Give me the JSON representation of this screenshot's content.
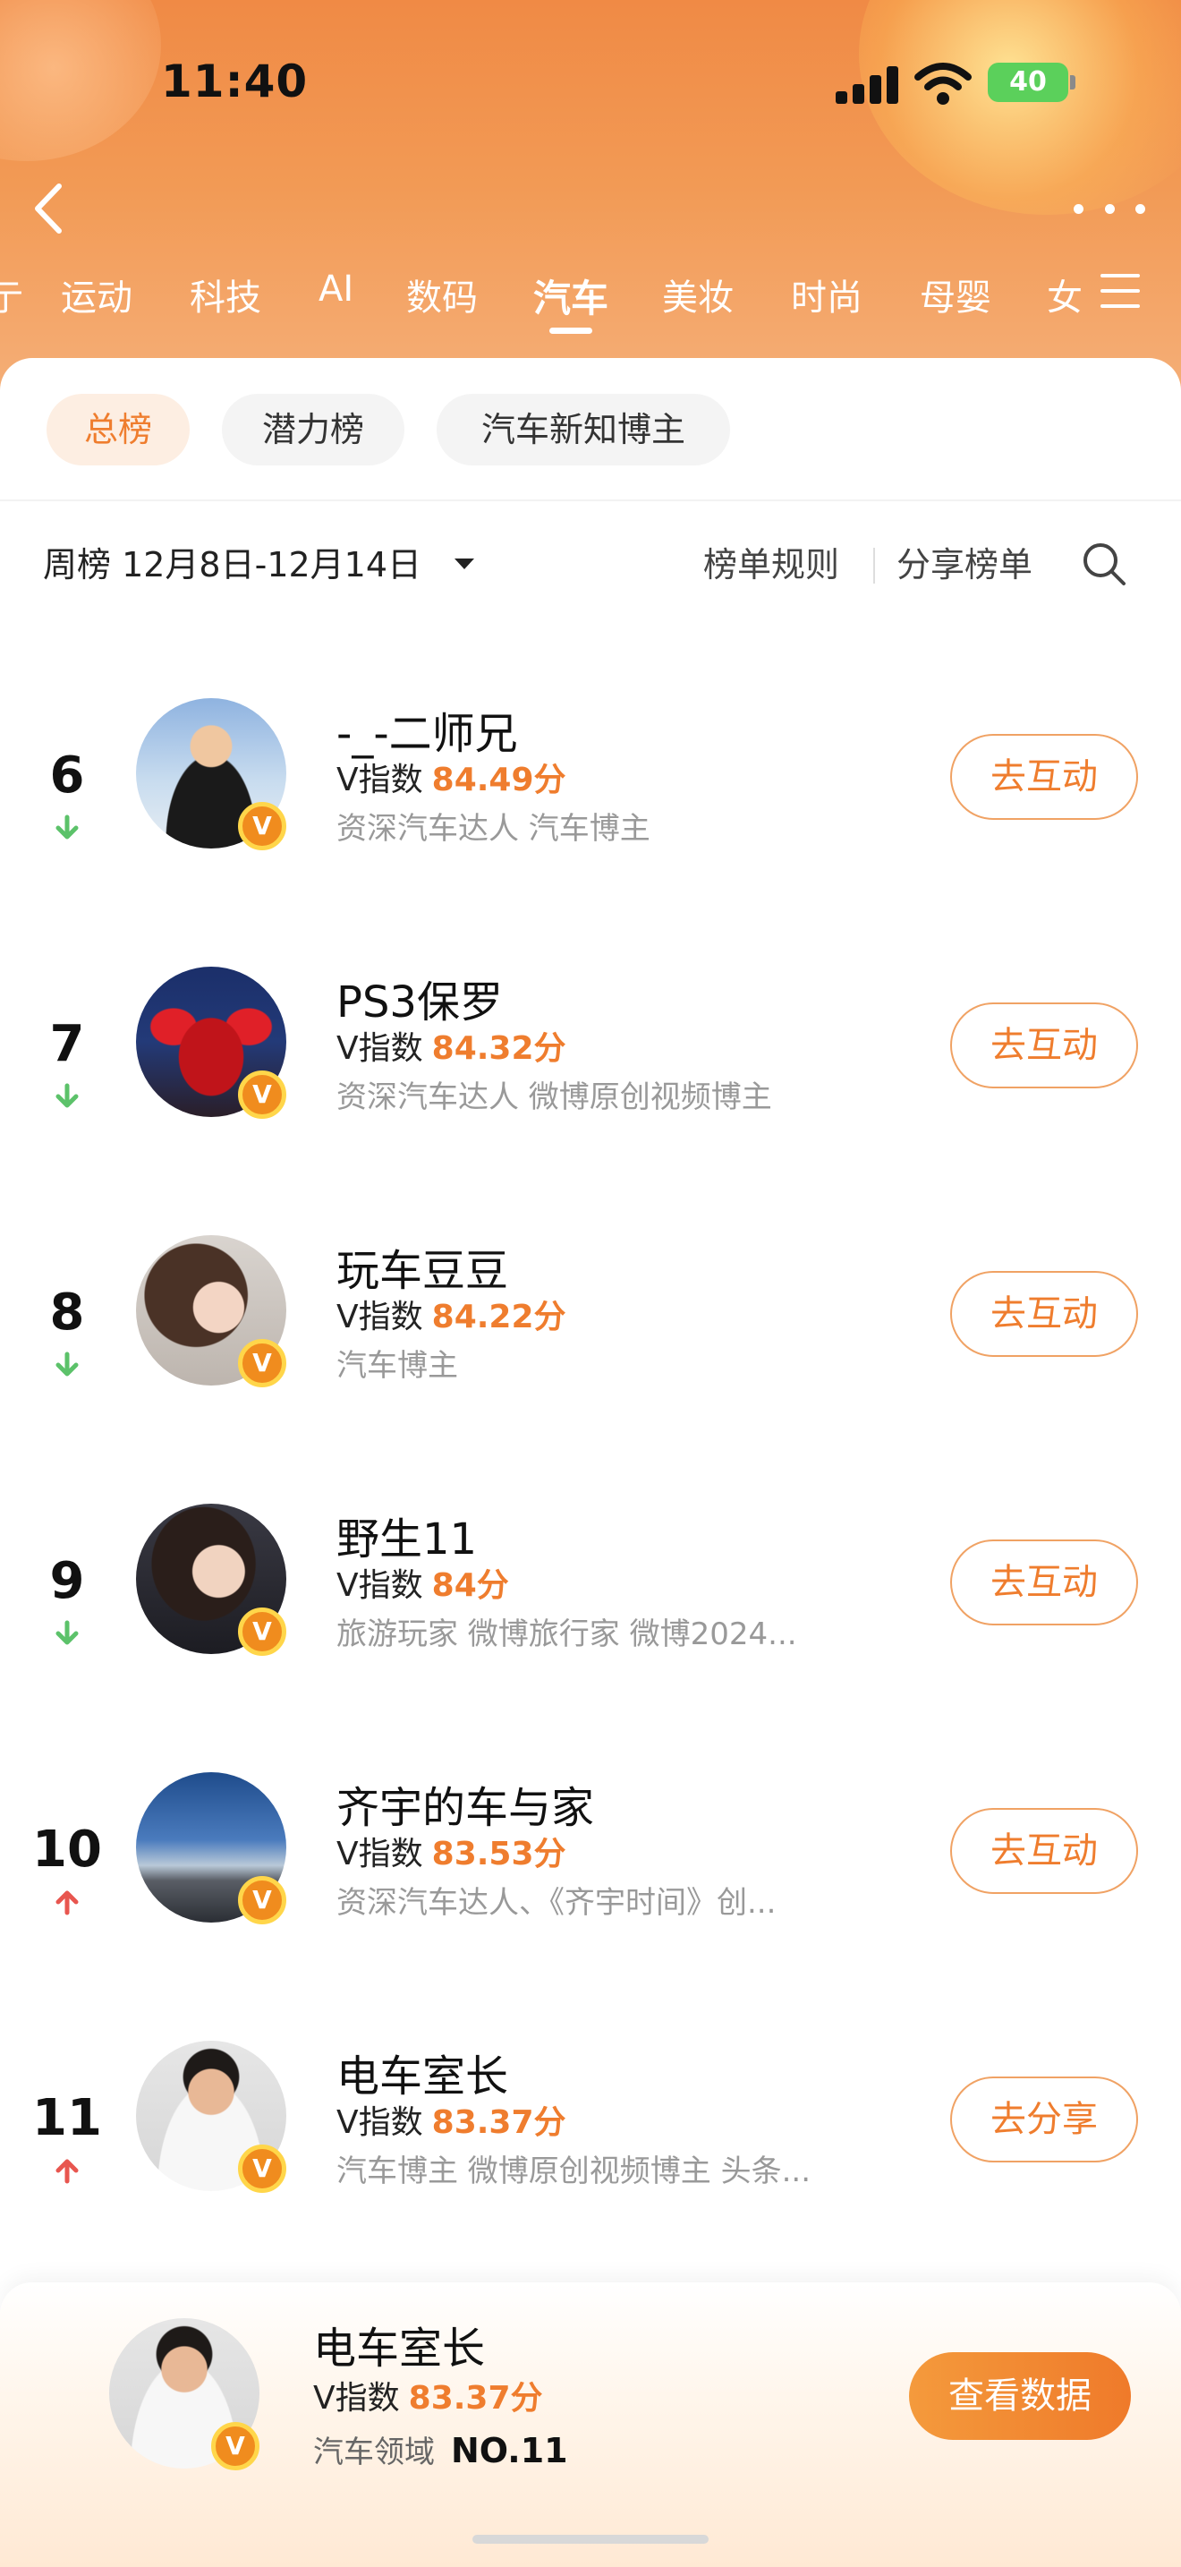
{
  "status_bar": {
    "time": "11:40",
    "battery": "40"
  },
  "tabs": [
    {
      "label": "运动"
    },
    {
      "label": "科技"
    },
    {
      "label": "AI"
    },
    {
      "label": "数码"
    },
    {
      "label": "汽车"
    },
    {
      "label": "美妆"
    },
    {
      "label": "时尚"
    },
    {
      "label": "母婴"
    },
    {
      "label": "女"
    }
  ],
  "active_tab": "汽车",
  "sub_tabs": [
    {
      "label": "总榜"
    },
    {
      "label": "潜力榜"
    },
    {
      "label": "汽车新知博主"
    }
  ],
  "filter": {
    "period": "周榜 12月8日-12月14日",
    "rules": "榜单规则",
    "share": "分享榜单"
  },
  "v_label": "V指数",
  "v_badge": "V",
  "list": [
    {
      "rank": "6",
      "trend": "down",
      "name": "-_-二师兄",
      "score": "84.49分",
      "desc": "资深汽车达人 汽车博主",
      "action": "去互动"
    },
    {
      "rank": "7",
      "trend": "down",
      "name": "PS3保罗",
      "score": "84.32分",
      "desc": "资深汽车达人 微博原创视频博主",
      "action": "去互动"
    },
    {
      "rank": "8",
      "trend": "down",
      "name": "玩车豆豆",
      "score": "84.22分",
      "desc": "汽车博主",
      "action": "去互动"
    },
    {
      "rank": "9",
      "trend": "down",
      "name": "野生11",
      "score": "84分",
      "desc": "旅游玩家 微博旅行家 微博2024...",
      "action": "去互动"
    },
    {
      "rank": "10",
      "trend": "up",
      "name": "齐宇的车与家",
      "score": "83.53分",
      "desc": "资深汽车达人、《齐宇时间》创...",
      "action": "去互动"
    },
    {
      "rank": "11",
      "trend": "up",
      "name": "电车室长",
      "score": "83.37分",
      "desc": "汽车博主 微博原创视频博主 头条...",
      "action": "去分享"
    }
  ],
  "bottom": {
    "name": "电车室长",
    "score": "83.37分",
    "field": "汽车领域",
    "rank_label": "NO.11",
    "button": "查看数据"
  },
  "colors": {
    "accent": "#ef7d2e",
    "down": "#5cc26a",
    "up": "#e8564f"
  }
}
